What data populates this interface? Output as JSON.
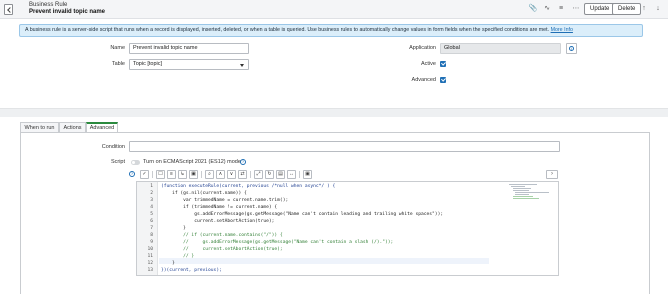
{
  "header": {
    "title": "Business Rule",
    "subtitle": "Prevent invalid topic name",
    "buttons": {
      "update": "Update",
      "delete": "Delete"
    },
    "icons": [
      "back-icon",
      "attachment-icon",
      "activity-icon",
      "settings-icon",
      "more-icon",
      "up-arrow-icon",
      "down-arrow-icon"
    ]
  },
  "banner": {
    "text": "A business rule is a server-side script that runs when a record is displayed, inserted, deleted, or when a table is queried. Use business rules to automatically change values in form fields when the specified conditions are met.",
    "link": "More Info"
  },
  "form": {
    "name": {
      "label": "Name",
      "value": "Prevent invalid topic name"
    },
    "table": {
      "label": "Table",
      "value": "Topic [topic]"
    },
    "application": {
      "label": "Application",
      "value": "Global"
    },
    "active": {
      "label": "Active",
      "checked": true
    },
    "advanced": {
      "label": "Advanced",
      "checked": true
    }
  },
  "tabs": [
    {
      "label": "When to run",
      "active": false
    },
    {
      "label": "Actions",
      "active": false
    },
    {
      "label": "Advanced",
      "active": true
    }
  ],
  "advanced": {
    "condition_label": "Condition",
    "condition_value": "",
    "script_label": "Script",
    "es12_toggle_label": "Turn on ECMAScript 2021 (ES12) mode",
    "es12_enabled": false
  },
  "editor": {
    "line_numbers": [
      "1",
      "2",
      "3",
      "4",
      "5",
      "6",
      "7",
      "8",
      "9",
      "10",
      "11",
      "12",
      "13"
    ],
    "lines": [
      "(function executeRule(current, previous /*null when async*/ ) {",
      "    if (gs.nil(current.name)) {",
      "        var trimmedName = current.name.trim();",
      "        if (trimmedName != current.name) {",
      "            gs.addErrorMessage(gs.getMessage(\"Name can't contain leading and trailing white spaces\"));",
      "            current.setAbortAction(true);",
      "        }",
      "        // if (current.name.contains(\"/\")) {",
      "        //     gs.addErrorMessage(gs.getMessage(\"Name can't contain a slash (/).\"));",
      "        //     current.setAbortAction(true);",
      "        // }",
      "    }",
      "})(current, previous);"
    ]
  },
  "colors": {
    "accent": "#1f6fb5",
    "tab_active": "#2b8a3e",
    "banner_bg": "#dbeefa",
    "comment": "#2e7d32"
  }
}
